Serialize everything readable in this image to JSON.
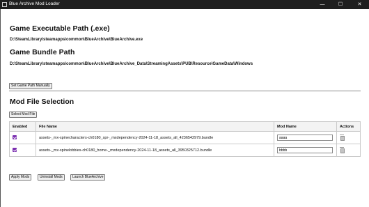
{
  "window": {
    "title": "Blue Archive Mod Loader",
    "minimize_glyph": "—",
    "maximize_glyph": "☐",
    "close_glyph": "✕"
  },
  "game_exe": {
    "heading": "Game Executable Path (.exe)",
    "path": "D:\\SteamLibrary\\steamapps\\common\\BlueArchive\\BlueArchive.exe"
  },
  "game_bundle": {
    "heading": "Game Bundle Path",
    "path": "D:\\SteamLibrary\\steamapps\\common\\BlueArchive\\BlueArchive_Data\\StreamingAssets\\PUB\\Resource\\GameData\\Windows"
  },
  "set_path_button": "Set Game Path Manually",
  "mod_section": {
    "heading": "Mod File Selection",
    "select_button": "Select Mod File",
    "columns": [
      "Enabled",
      "File Name",
      "Mod Name",
      "Actions"
    ],
    "rows": [
      {
        "enabled": true,
        "file_name": "assets-_mx-spinecharacters-ch0180_spr-_mxdependency-2024-11-18_assets_all_4236542979.bundle",
        "mod_name": "aaaa",
        "action_icon": "trash-icon"
      },
      {
        "enabled": true,
        "file_name": "assets-_mx-spinelobbies-ch0180_home-_mxdependency-2024-11-18_assets_all_3950325712.bundle",
        "mod_name": "bbbb",
        "action_icon": "trash-icon"
      }
    ]
  },
  "footer_buttons": {
    "apply": "Apply Mods",
    "uninstall": "Uninstall Mods",
    "launch": "Launch BlueArchive"
  },
  "colors": {
    "titlebar": "#1f1f1f",
    "checkbox_accent": "#7b2fb0",
    "button_bg": "#efefef",
    "table_border": "#c9c9c9"
  }
}
